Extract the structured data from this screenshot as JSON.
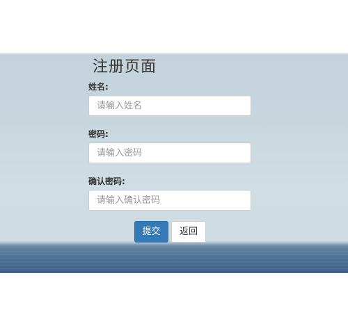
{
  "page": {
    "title": "注册页面"
  },
  "form": {
    "name_label": "姓名:",
    "name_placeholder": "请输入姓名",
    "name_value": "",
    "password_label": "密码:",
    "password_placeholder": "请输入密码",
    "password_value": "",
    "confirm_label": "确认密码:",
    "confirm_placeholder": "请输入确认密码",
    "confirm_value": "",
    "submit_label": "提交",
    "back_label": "返回"
  },
  "colors": {
    "primary": "#337ab7",
    "primary_border": "#2e6da4",
    "text": "#333333",
    "placeholder": "#999999"
  }
}
